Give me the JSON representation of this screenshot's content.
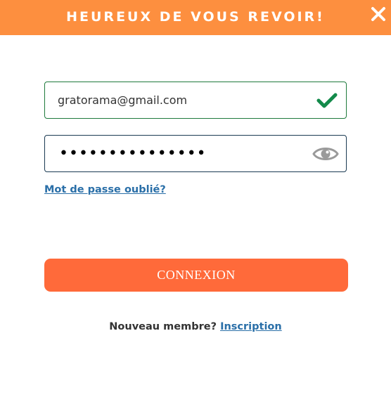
{
  "header": {
    "title": "HEUREUX DE VOUS REVOIR!",
    "close_icon": "close-icon"
  },
  "email": {
    "value": "gratorama@gmail.com",
    "status_icon": "check-icon",
    "status_color": "#138a4a"
  },
  "password": {
    "value": "•••••••••••••••",
    "toggle_icon": "eye-icon"
  },
  "forgot_password": {
    "label": "Mot de passe oublié?"
  },
  "login_button": {
    "label": "CONNEXION"
  },
  "signup": {
    "prompt": "Nouveau membre?",
    "link_label": "Inscription"
  },
  "colors": {
    "header": "#fd8f3f",
    "button": "#ff6a3a",
    "link": "#2a6fa8"
  }
}
